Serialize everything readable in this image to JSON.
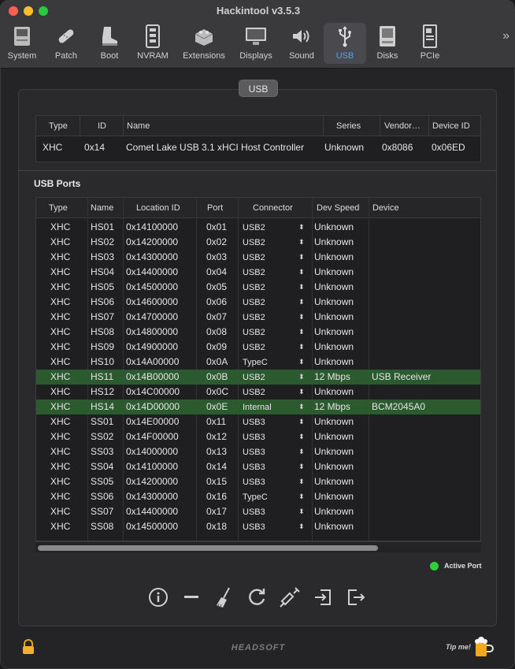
{
  "window": {
    "title": "Hackintool v3.5.3"
  },
  "toolbar": {
    "items": [
      {
        "label": "System",
        "icon": "system-icon"
      },
      {
        "label": "Patch",
        "icon": "patch-icon"
      },
      {
        "label": "Boot",
        "icon": "boot-icon"
      },
      {
        "label": "NVRAM",
        "icon": "nvram-icon"
      },
      {
        "label": "Extensions",
        "icon": "extensions-icon"
      },
      {
        "label": "Displays",
        "icon": "displays-icon"
      },
      {
        "label": "Sound",
        "icon": "sound-icon"
      },
      {
        "label": "USB",
        "icon": "usb-icon",
        "active": true
      },
      {
        "label": "Disks",
        "icon": "disks-icon"
      },
      {
        "label": "PCIe",
        "icon": "pcie-icon"
      }
    ],
    "overflow": "»"
  },
  "tab": {
    "label": "USB"
  },
  "controllers": {
    "columns": [
      "Type",
      "ID",
      "Name",
      "Series",
      "Vendor…",
      "Device ID"
    ],
    "rows": [
      {
        "type": "XHC",
        "id": "0x14",
        "name": "Comet Lake USB 3.1 xHCI Host Controller",
        "series": "Unknown",
        "vendor": "0x8086",
        "device_id": "0x06ED"
      }
    ]
  },
  "ports": {
    "title": "USB Ports",
    "columns": [
      "Type",
      "Name",
      "Location ID",
      "Port",
      "Connector",
      "Dev Speed",
      "Device"
    ],
    "rows": [
      {
        "type": "XHC",
        "name": "HS01",
        "location": "0x14100000",
        "port": "0x01",
        "connector": "USB2",
        "speed": "Unknown",
        "device": "",
        "active": false
      },
      {
        "type": "XHC",
        "name": "HS02",
        "location": "0x14200000",
        "port": "0x02",
        "connector": "USB2",
        "speed": "Unknown",
        "device": "",
        "active": false
      },
      {
        "type": "XHC",
        "name": "HS03",
        "location": "0x14300000",
        "port": "0x03",
        "connector": "USB2",
        "speed": "Unknown",
        "device": "",
        "active": false
      },
      {
        "type": "XHC",
        "name": "HS04",
        "location": "0x14400000",
        "port": "0x04",
        "connector": "USB2",
        "speed": "Unknown",
        "device": "",
        "active": false
      },
      {
        "type": "XHC",
        "name": "HS05",
        "location": "0x14500000",
        "port": "0x05",
        "connector": "USB2",
        "speed": "Unknown",
        "device": "",
        "active": false
      },
      {
        "type": "XHC",
        "name": "HS06",
        "location": "0x14600000",
        "port": "0x06",
        "connector": "USB2",
        "speed": "Unknown",
        "device": "",
        "active": false
      },
      {
        "type": "XHC",
        "name": "HS07",
        "location": "0x14700000",
        "port": "0x07",
        "connector": "USB2",
        "speed": "Unknown",
        "device": "",
        "active": false
      },
      {
        "type": "XHC",
        "name": "HS08",
        "location": "0x14800000",
        "port": "0x08",
        "connector": "USB2",
        "speed": "Unknown",
        "device": "",
        "active": false
      },
      {
        "type": "XHC",
        "name": "HS09",
        "location": "0x14900000",
        "port": "0x09",
        "connector": "USB2",
        "speed": "Unknown",
        "device": "",
        "active": false
      },
      {
        "type": "XHC",
        "name": "HS10",
        "location": "0x14A00000",
        "port": "0x0A",
        "connector": "TypeC",
        "speed": "Unknown",
        "device": "",
        "active": false
      },
      {
        "type": "XHC",
        "name": "HS11",
        "location": "0x14B00000",
        "port": "0x0B",
        "connector": "USB2",
        "speed": "12 Mbps",
        "device": "USB Receiver",
        "active": true
      },
      {
        "type": "XHC",
        "name": "HS12",
        "location": "0x14C00000",
        "port": "0x0C",
        "connector": "USB2",
        "speed": "Unknown",
        "device": "",
        "active": false
      },
      {
        "type": "XHC",
        "name": "HS14",
        "location": "0x14D00000",
        "port": "0x0E",
        "connector": "Internal",
        "speed": "12 Mbps",
        "device": "BCM2045A0",
        "active": true
      },
      {
        "type": "XHC",
        "name": "SS01",
        "location": "0x14E00000",
        "port": "0x11",
        "connector": "USB3",
        "speed": "Unknown",
        "device": "",
        "active": false
      },
      {
        "type": "XHC",
        "name": "SS02",
        "location": "0x14F00000",
        "port": "0x12",
        "connector": "USB3",
        "speed": "Unknown",
        "device": "",
        "active": false
      },
      {
        "type": "XHC",
        "name": "SS03",
        "location": "0x14000000",
        "port": "0x13",
        "connector": "USB3",
        "speed": "Unknown",
        "device": "",
        "active": false
      },
      {
        "type": "XHC",
        "name": "SS04",
        "location": "0x14100000",
        "port": "0x14",
        "connector": "USB3",
        "speed": "Unknown",
        "device": "",
        "active": false
      },
      {
        "type": "XHC",
        "name": "SS05",
        "location": "0x14200000",
        "port": "0x15",
        "connector": "USB3",
        "speed": "Unknown",
        "device": "",
        "active": false
      },
      {
        "type": "XHC",
        "name": "SS06",
        "location": "0x14300000",
        "port": "0x16",
        "connector": "TypeC",
        "speed": "Unknown",
        "device": "",
        "active": false
      },
      {
        "type": "XHC",
        "name": "SS07",
        "location": "0x14400000",
        "port": "0x17",
        "connector": "USB3",
        "speed": "Unknown",
        "device": "",
        "active": false
      },
      {
        "type": "XHC",
        "name": "SS08",
        "location": "0x14500000",
        "port": "0x18",
        "connector": "USB3",
        "speed": "Unknown",
        "device": "",
        "active": false
      }
    ]
  },
  "legend": {
    "label": "Active Port",
    "color": "#2fcf3b"
  },
  "actions": [
    "info-icon",
    "minus-icon",
    "broom-icon",
    "refresh-icon",
    "syringe-icon",
    "import-icon",
    "export-icon"
  ],
  "footer": {
    "brand": "HEADSOFT",
    "tip": "Tip me!",
    "lock_icon": "lock-icon",
    "beer_icon": "beer-icon"
  },
  "colors": {
    "active_row": "#2b5a2e",
    "accent": "#4aa3ff"
  }
}
